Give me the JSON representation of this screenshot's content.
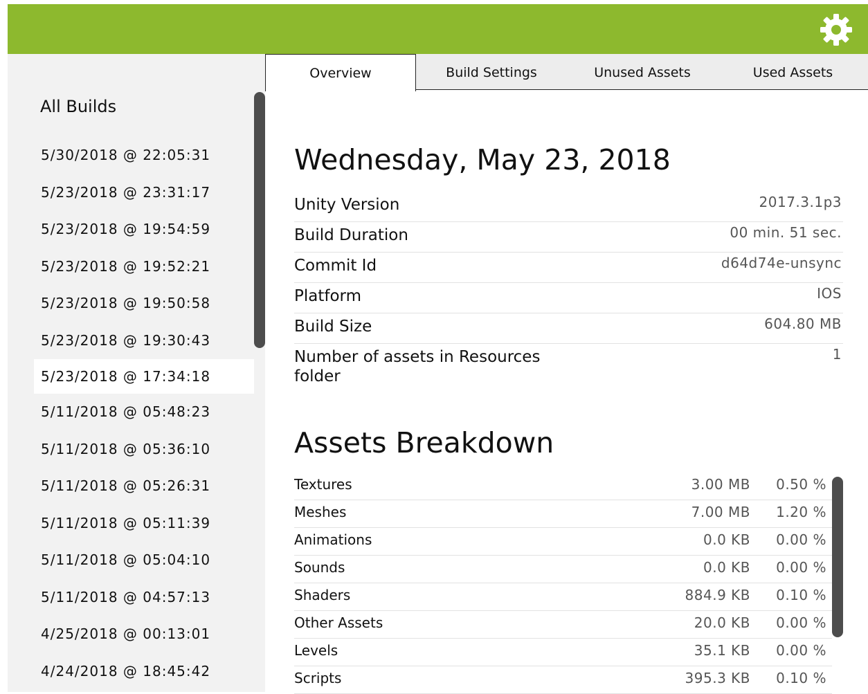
{
  "header": {
    "settings_icon": "gear-icon",
    "accent_color": "#8db92e"
  },
  "sidebar": {
    "title": "All Builds",
    "builds": [
      {
        "label": "5/30/2018 @ 22:05:31"
      },
      {
        "label": "5/23/2018 @ 23:31:17"
      },
      {
        "label": "5/23/2018 @ 19:54:59"
      },
      {
        "label": "5/23/2018 @ 19:52:21"
      },
      {
        "label": "5/23/2018 @ 19:50:58"
      },
      {
        "label": "5/23/2018 @ 19:30:43"
      },
      {
        "label": "5/23/2018 @ 17:34:18",
        "selected": true
      },
      {
        "label": "5/11/2018 @ 05:48:23"
      },
      {
        "label": "5/11/2018 @ 05:36:10"
      },
      {
        "label": "5/11/2018 @ 05:26:31"
      },
      {
        "label": "5/11/2018 @ 05:11:39"
      },
      {
        "label": "5/11/2018 @ 05:04:10"
      },
      {
        "label": "5/11/2018 @ 04:57:13"
      },
      {
        "label": "4/25/2018 @ 00:13:01"
      },
      {
        "label": "4/24/2018 @ 18:45:42"
      }
    ]
  },
  "tabs": [
    {
      "label": "Overview",
      "active": true
    },
    {
      "label": "Build Settings"
    },
    {
      "label": "Unused Assets"
    },
    {
      "label": "Used Assets"
    }
  ],
  "overview": {
    "date_heading": "Wednesday, May 23, 2018",
    "rows": [
      {
        "label": "Unity Version",
        "value": "2017.3.1p3"
      },
      {
        "label": "Build Duration",
        "value": "00 min. 51 sec."
      },
      {
        "label": "Commit Id",
        "value": "d64d74e-unsync"
      },
      {
        "label": "Platform",
        "value": "IOS"
      },
      {
        "label": "Build Size",
        "value": "604.80 MB"
      },
      {
        "label": "Number of assets in Resources folder",
        "value": "1"
      }
    ]
  },
  "assets_breakdown": {
    "heading": "Assets Breakdown",
    "rows": [
      {
        "name": "Textures",
        "size": "3.00 MB",
        "percent": "0.50 %"
      },
      {
        "name": "Meshes",
        "size": "7.00 MB",
        "percent": "1.20 %"
      },
      {
        "name": "Animations",
        "size": "0.0 KB",
        "percent": "0.00 %"
      },
      {
        "name": "Sounds",
        "size": "0.0 KB",
        "percent": "0.00 %"
      },
      {
        "name": "Shaders",
        "size": "884.9 KB",
        "percent": "0.10 %"
      },
      {
        "name": "Other Assets",
        "size": "20.0 KB",
        "percent": "0.00 %"
      },
      {
        "name": "Levels",
        "size": "35.1 KB",
        "percent": "0.00 %"
      },
      {
        "name": "Scripts",
        "size": "395.3 KB",
        "percent": "0.10 %"
      }
    ]
  }
}
